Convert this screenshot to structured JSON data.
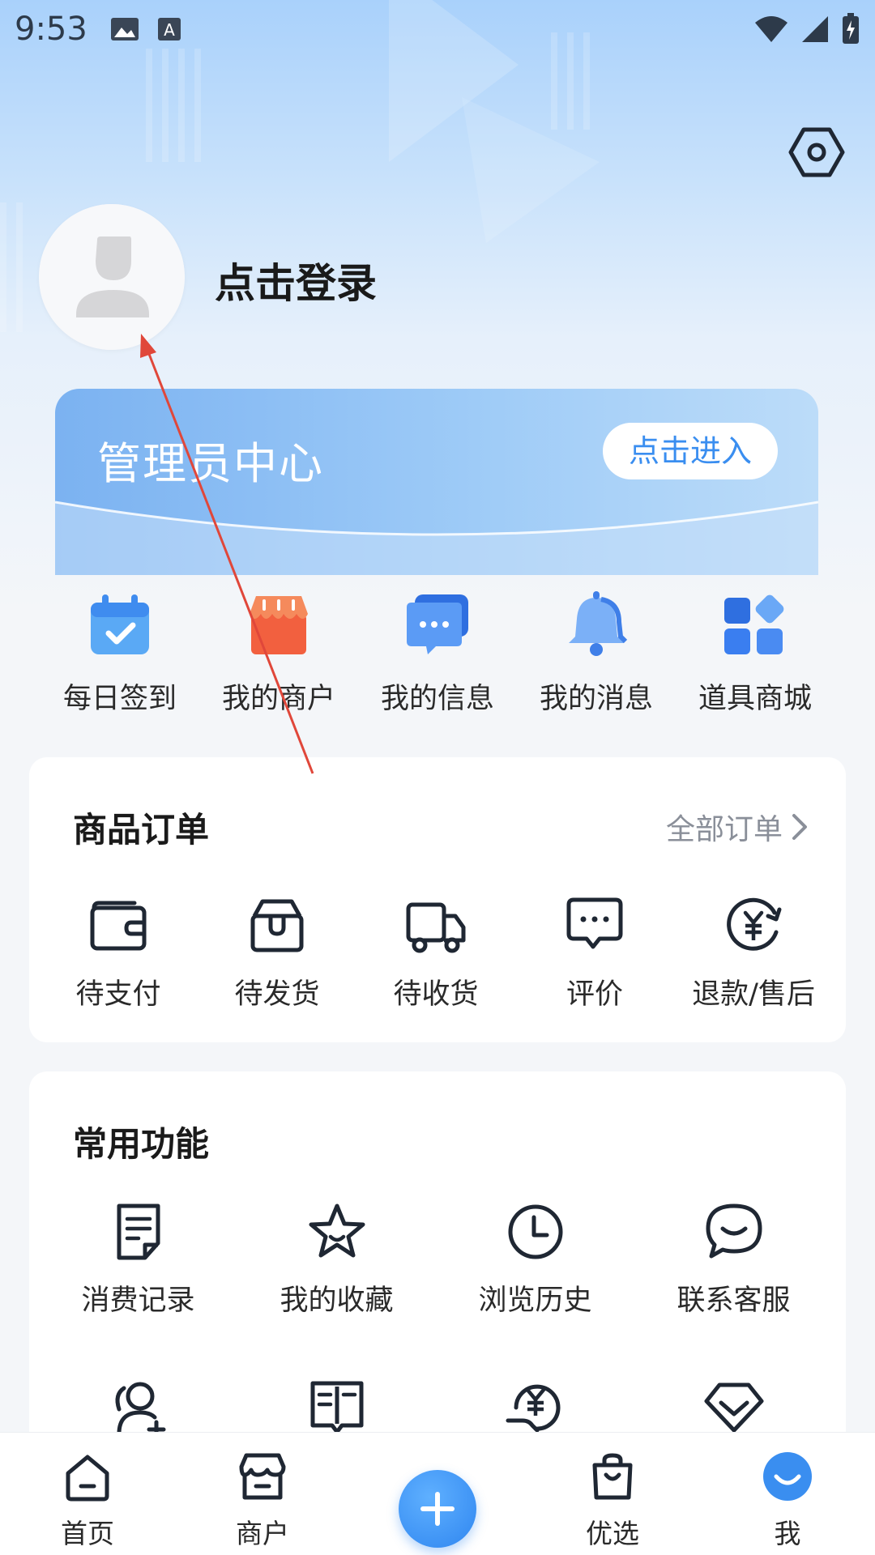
{
  "status_bar": {
    "time": "9:53"
  },
  "profile": {
    "login_text": "点击登录"
  },
  "admin_center": {
    "title": "管理员中心",
    "enter_label": "点击进入"
  },
  "quick_actions": [
    {
      "label": "每日签到",
      "icon": "calendar-check-icon"
    },
    {
      "label": "我的商户",
      "icon": "storefront-icon"
    },
    {
      "label": "我的信息",
      "icon": "chat-bubble-icon"
    },
    {
      "label": "我的消息",
      "icon": "bell-icon"
    },
    {
      "label": "道具商城",
      "icon": "grid-apps-icon"
    }
  ],
  "orders": {
    "title": "商品订单",
    "all_label": "全部订单",
    "items": [
      {
        "label": "待支付",
        "icon": "wallet-icon"
      },
      {
        "label": "待发货",
        "icon": "package-icon"
      },
      {
        "label": "待收货",
        "icon": "truck-icon"
      },
      {
        "label": "评价",
        "icon": "comment-icon"
      },
      {
        "label": "退款/售后",
        "icon": "refund-icon"
      }
    ]
  },
  "common_functions": {
    "title": "常用功能",
    "items": [
      {
        "label": "消费记录",
        "icon": "receipt-icon"
      },
      {
        "label": "我的收藏",
        "icon": "star-icon"
      },
      {
        "label": "浏览历史",
        "icon": "clock-icon"
      },
      {
        "label": "联系客服",
        "icon": "service-chat-icon"
      }
    ],
    "second_row_icons": [
      "add-user-icon",
      "book-icon",
      "yuan-hand-icon",
      "diamond-icon"
    ]
  },
  "tab_bar": [
    {
      "label": "首页",
      "icon": "home-icon"
    },
    {
      "label": "商户",
      "icon": "shop-icon"
    },
    {
      "label": "",
      "icon": "plus-icon"
    },
    {
      "label": "优选",
      "icon": "shopping-bag-icon"
    },
    {
      "label": "我",
      "icon": "profile-smile-icon"
    }
  ],
  "colors": {
    "accent": "#3a8ef0",
    "banner_start": "#7bb2f1",
    "text_primary": "#1a1a1a",
    "text_secondary": "#8a8f99",
    "annotation_arrow": "#e0473a"
  }
}
